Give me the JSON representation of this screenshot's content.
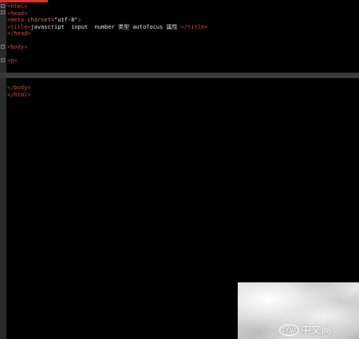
{
  "editor": {
    "lines": [
      {
        "fold": "-",
        "parts": [
          {
            "c": "tag",
            "t": "<html>"
          }
        ]
      },
      {
        "fold": "-",
        "parts": [
          {
            "c": "tag",
            "t": "<head>"
          }
        ]
      },
      {
        "fold": "",
        "parts": [
          {
            "c": "tag",
            "t": "<meta "
          },
          {
            "c": "attr",
            "t": "charset="
          },
          {
            "c": "str",
            "t": "\"utf-8\""
          },
          {
            "c": "tag",
            "t": ">"
          }
        ]
      },
      {
        "fold": "",
        "parts": [
          {
            "c": "tag",
            "t": "<title>"
          },
          {
            "c": "txt",
            "t": "javascript  input  number 类型 autofocus 属性 "
          },
          {
            "c": "tag",
            "t": "</title>"
          }
        ]
      },
      {
        "fold": "",
        "parts": [
          {
            "c": "tag",
            "t": "</head>"
          }
        ]
      },
      {
        "fold": "",
        "parts": []
      },
      {
        "fold": "-",
        "parts": [
          {
            "c": "tag",
            "t": "<body> "
          }
        ]
      },
      {
        "fold": "",
        "parts": []
      },
      {
        "fold": "-",
        "parts": [
          {
            "c": "tag",
            "t": "<p>"
          }
        ]
      },
      {
        "fold": "",
        "parts": []
      },
      {
        "fold": "",
        "parts": []
      },
      {
        "fold": "",
        "parts": []
      },
      {
        "fold": "",
        "parts": [
          {
            "c": "tag",
            "t": "</body>"
          }
        ]
      },
      {
        "fold": "",
        "parts": [
          {
            "c": "tag",
            "t": "</html>"
          }
        ]
      }
    ]
  },
  "watermark": {
    "logo_text": "php",
    "site_text": "中文网"
  },
  "colors": {
    "background": "#000000",
    "tag": "#d04844",
    "tab_indicator": "#e0302c"
  }
}
